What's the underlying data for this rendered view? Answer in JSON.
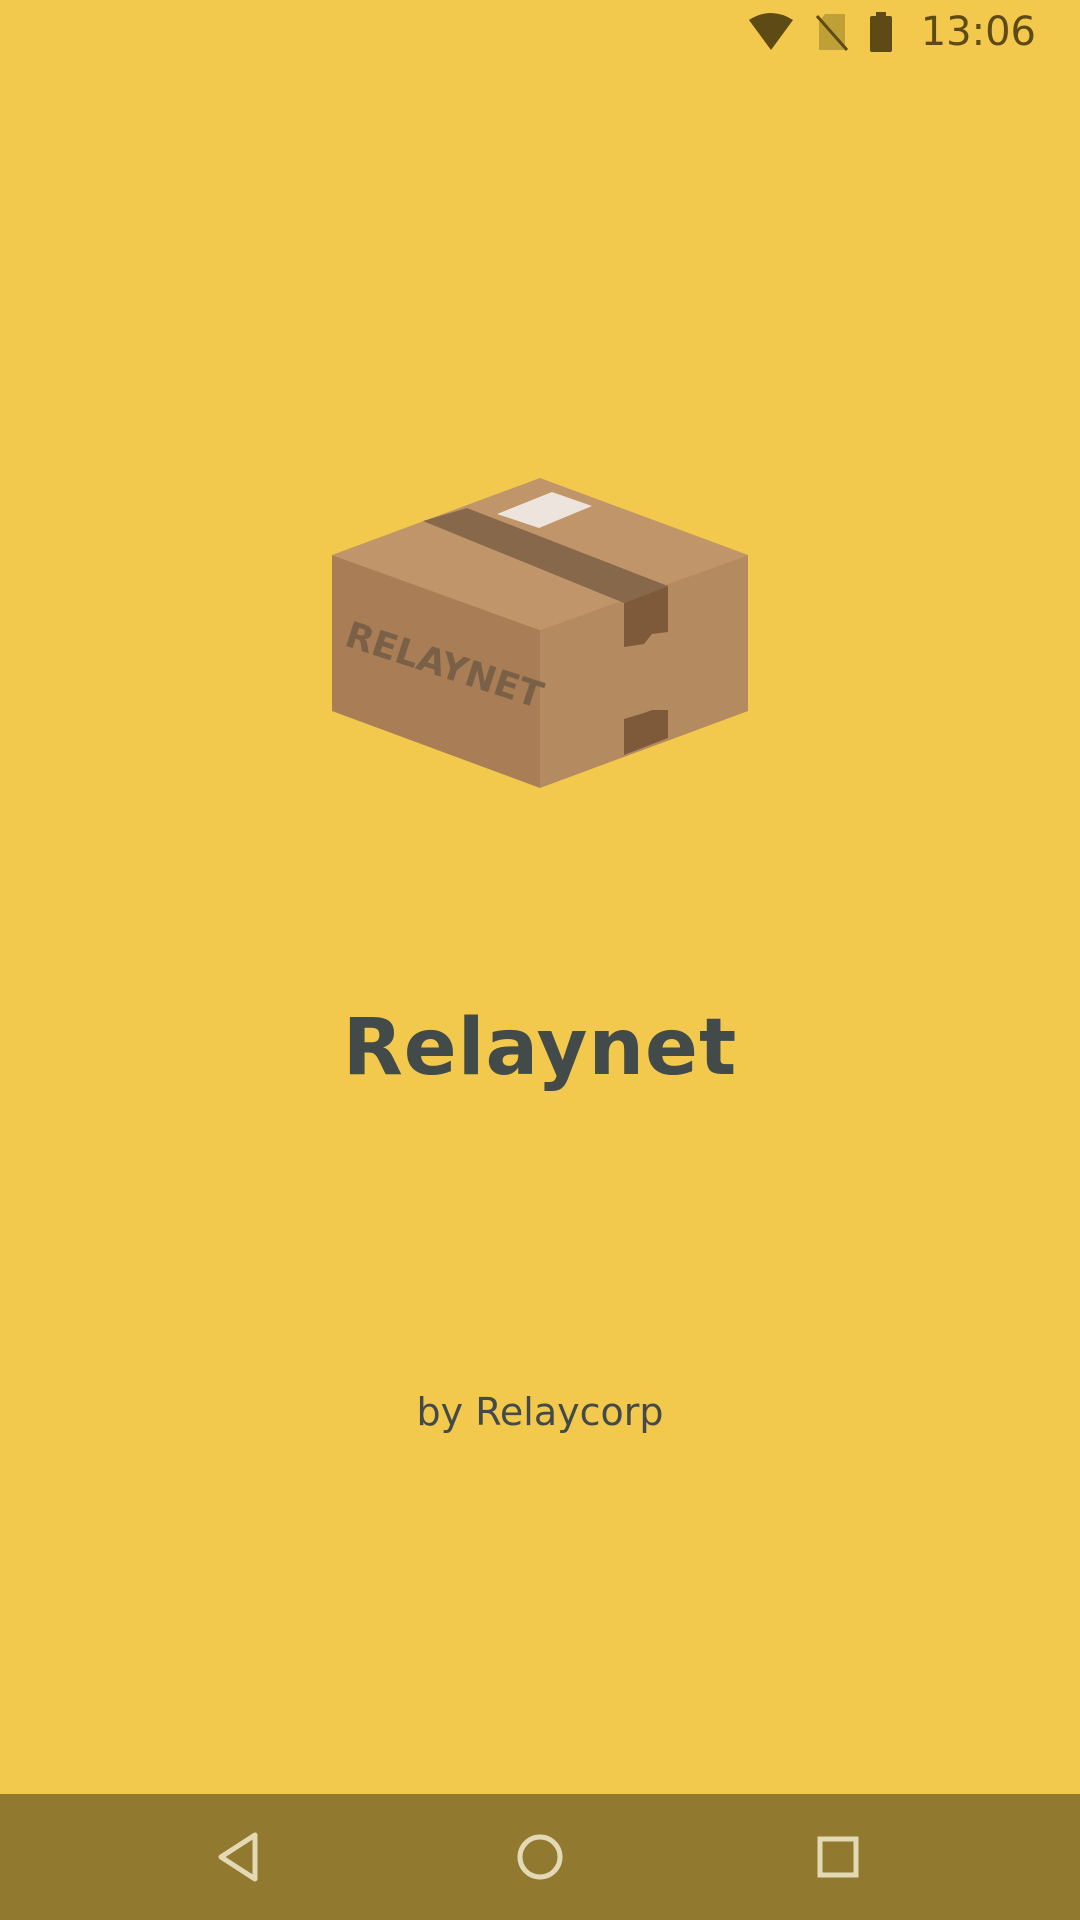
{
  "status_bar": {
    "time": "13:06",
    "icons": [
      "wifi-icon",
      "no-sim-icon",
      "battery-icon"
    ],
    "icon_color": "#5E4A14"
  },
  "splash": {
    "logo_label": "RELAYNET",
    "title": "Relaynet",
    "byline": "by Relaycorp"
  },
  "nav_bar": {
    "buttons": [
      "back",
      "home",
      "recents"
    ],
    "color": "#917A30",
    "icon_color": "#E4D9B5"
  },
  "colors": {
    "background": "#F2C94C",
    "text": "#424B4A"
  }
}
